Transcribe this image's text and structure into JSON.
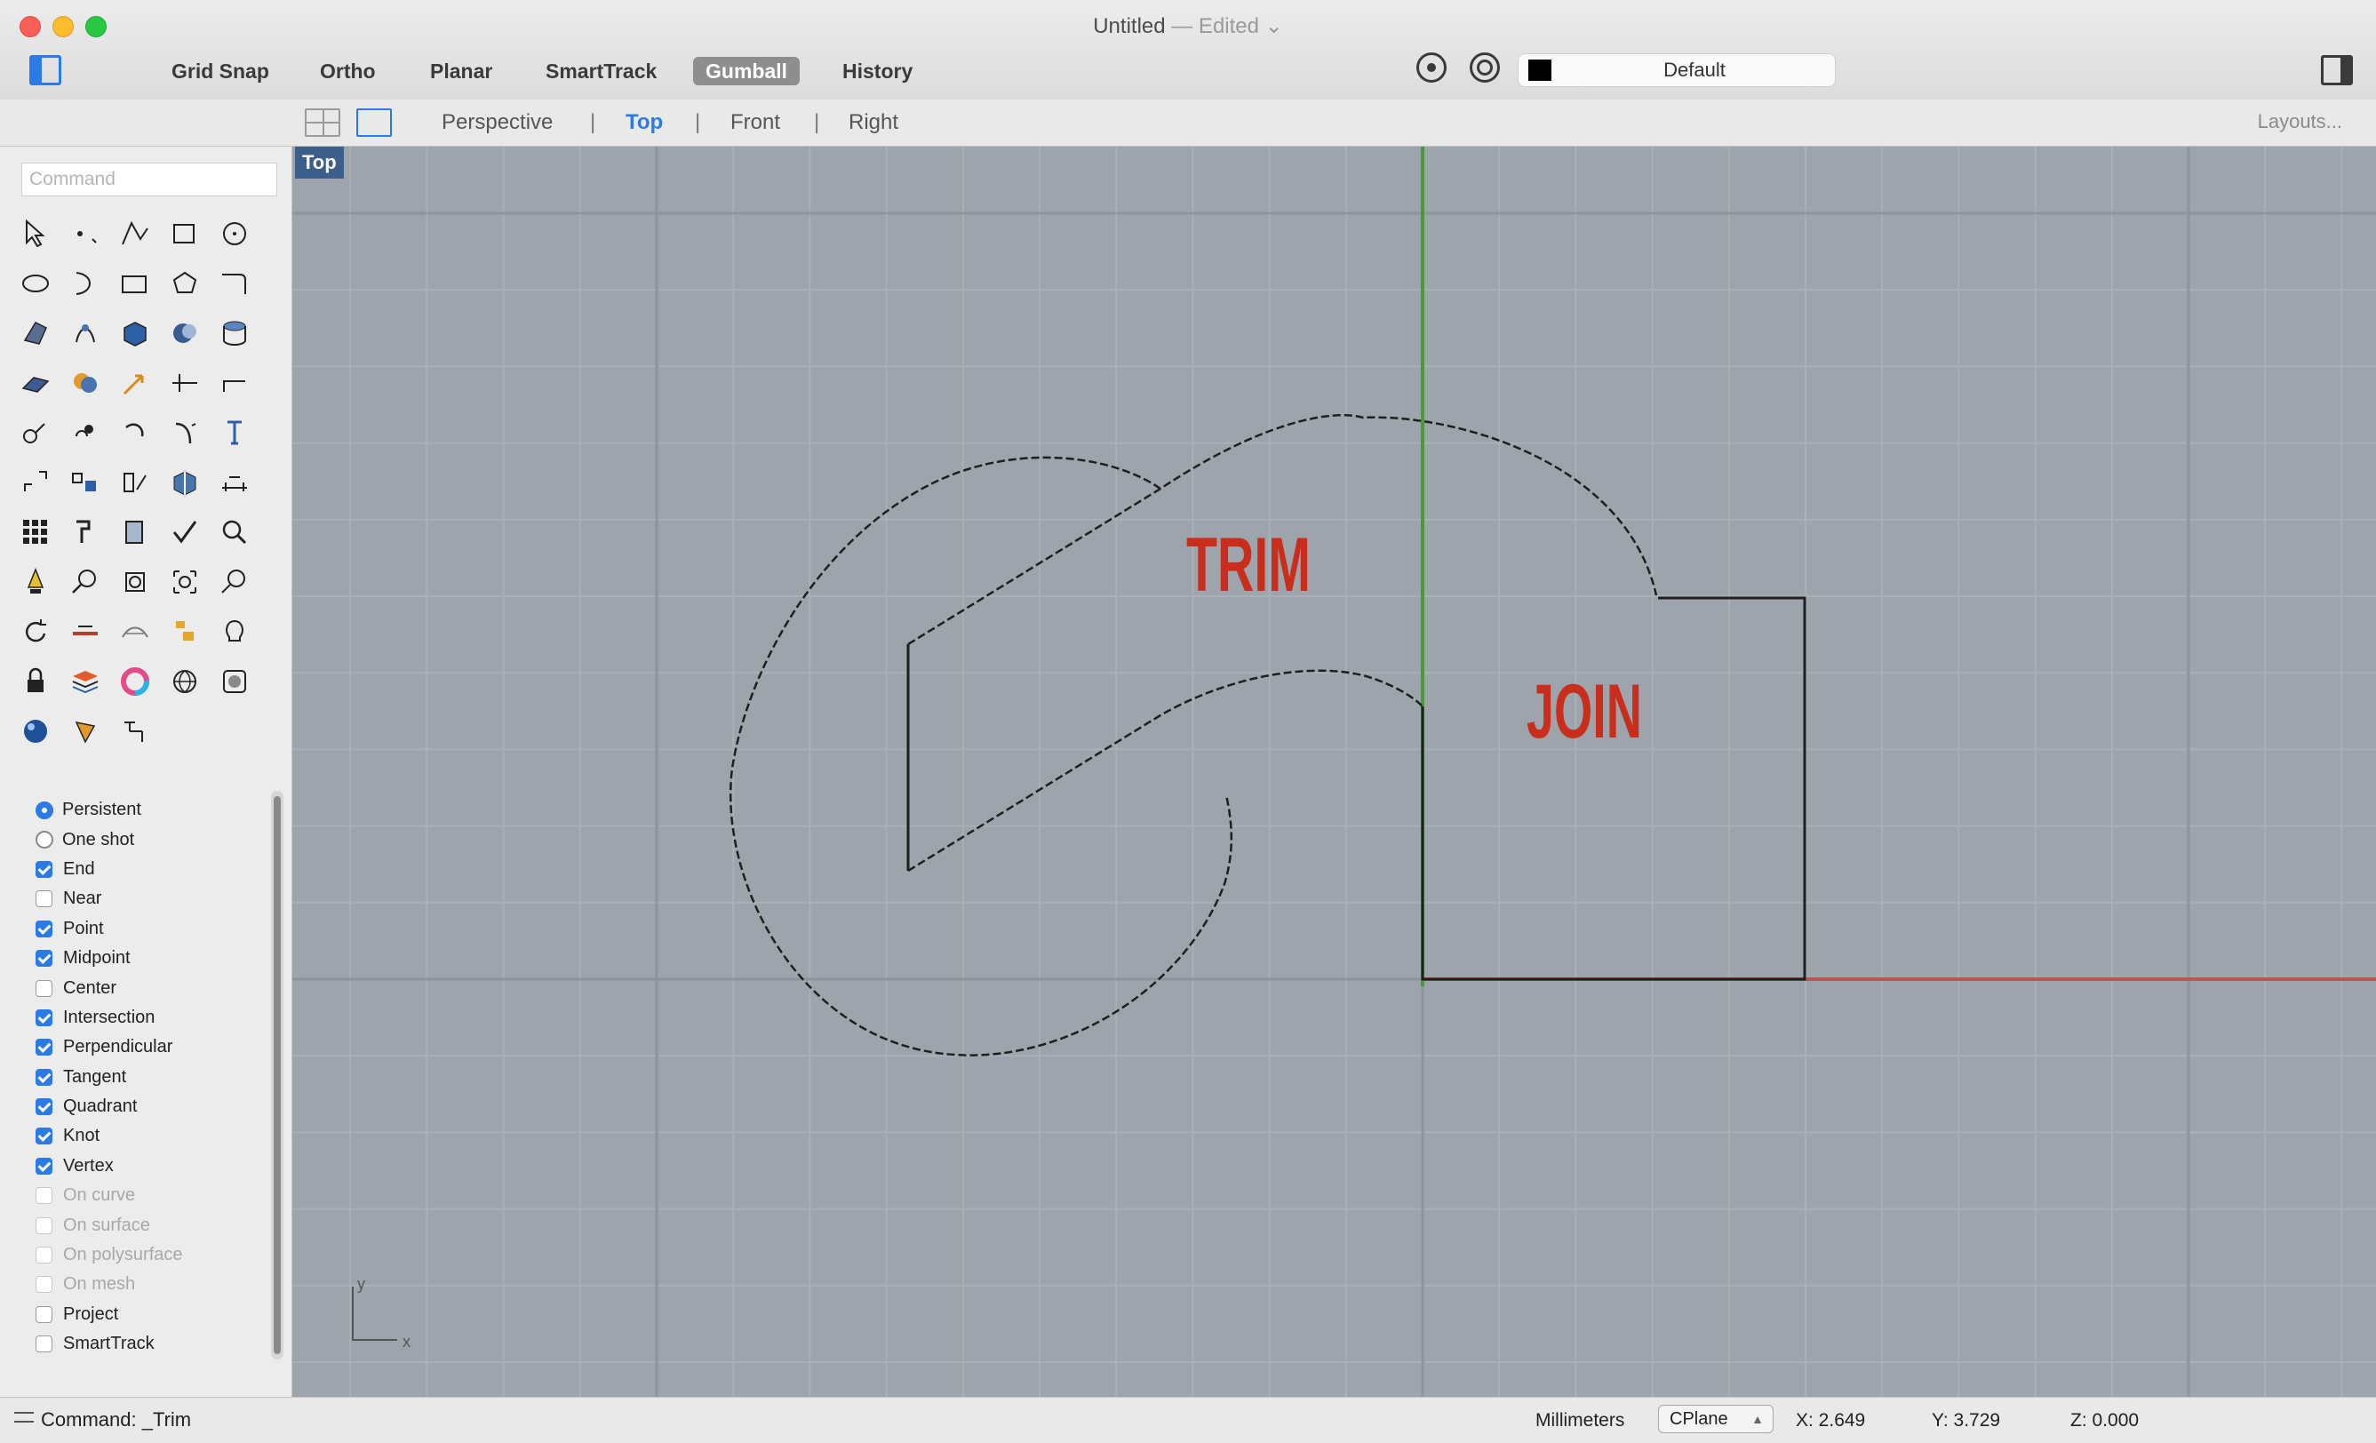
{
  "window": {
    "title": "Untitled",
    "edited": "— Edited ⌄"
  },
  "toolbar": {
    "modes": [
      {
        "label": "Grid Snap",
        "active": false
      },
      {
        "label": "Ortho",
        "active": false
      },
      {
        "label": "Planar",
        "active": false
      },
      {
        "label": "SmartTrack",
        "active": false
      },
      {
        "label": "Gumball",
        "active": true
      },
      {
        "label": "History",
        "active": false
      }
    ],
    "layer": {
      "name": "Default",
      "color": "#000000"
    }
  },
  "viewport_tabs": {
    "tabs": [
      "Perspective",
      "Top",
      "Front",
      "Right"
    ],
    "active": "Top",
    "layouts_link": "Layouts..."
  },
  "command": {
    "placeholder": "Command",
    "status": "Command: _Trim"
  },
  "tool_icons": [
    "select-arrow-icon",
    "point-icon",
    "polyline-icon",
    "curve-icon",
    "circle-icon",
    "ellipse-icon",
    "arc-icon",
    "rectangle-icon",
    "polygon-icon",
    "fillet-icon",
    "surface-icon",
    "loft-icon",
    "box-icon",
    "sphere-icon",
    "cylinder-icon",
    "extrude-icon",
    "boolean-icon",
    "move-icon",
    "trim-icon",
    "split-icon",
    "shell-icon",
    "group-icon",
    "rotate-icon",
    "scale-icon",
    "text-icon",
    "mirror-icon",
    "array-icon",
    "drape-icon",
    "solid-edit-icon",
    "dimension-icon",
    "grid-array-icon",
    "explode-icon",
    "paste-icon",
    "check-icon",
    "analyze-icon",
    "light-icon",
    "zoom-icon",
    "zoom-window-icon",
    "zoom-extents-icon",
    "zoom-selected-icon",
    "undo-view-icon",
    "section-icon",
    "mesh-icon",
    "properties-icon",
    "lightbulb-icon",
    "lock-icon",
    "layer-icon",
    "color-wheel-icon",
    "render-icon",
    "display-icon",
    "material-icon",
    "sun-icon",
    "snapshot-icon"
  ],
  "osnaps": {
    "modes": [
      {
        "label": "Persistent",
        "selected": true
      },
      {
        "label": "One shot",
        "selected": false
      }
    ],
    "items": [
      {
        "label": "End",
        "checked": true,
        "enabled": true
      },
      {
        "label": "Near",
        "checked": false,
        "enabled": true
      },
      {
        "label": "Point",
        "checked": true,
        "enabled": true
      },
      {
        "label": "Midpoint",
        "checked": true,
        "enabled": true
      },
      {
        "label": "Center",
        "checked": false,
        "enabled": true
      },
      {
        "label": "Intersection",
        "checked": true,
        "enabled": true
      },
      {
        "label": "Perpendicular",
        "checked": true,
        "enabled": true
      },
      {
        "label": "Tangent",
        "checked": true,
        "enabled": true
      },
      {
        "label": "Quadrant",
        "checked": true,
        "enabled": true
      },
      {
        "label": "Knot",
        "checked": true,
        "enabled": true
      },
      {
        "label": "Vertex",
        "checked": true,
        "enabled": true
      },
      {
        "label": "On curve",
        "checked": false,
        "enabled": false
      },
      {
        "label": "On surface",
        "checked": false,
        "enabled": false
      },
      {
        "label": "On polysurface",
        "checked": false,
        "enabled": false
      },
      {
        "label": "On mesh",
        "checked": false,
        "enabled": false
      },
      {
        "label": "Project",
        "checked": false,
        "enabled": true
      },
      {
        "label": "SmartTrack",
        "checked": false,
        "enabled": true
      }
    ]
  },
  "viewport": {
    "name": "Top",
    "annotations": {
      "trim": "TRIM",
      "join": "JOIN"
    },
    "axis_labels": {
      "x": "x",
      "y": "y"
    },
    "colors": {
      "background": "#9da4ac",
      "x_axis": "#c25252",
      "y_axis": "#4a9a3a",
      "annotation": "#c92e1d"
    }
  },
  "status": {
    "units": "Millimeters",
    "cplane": "CPlane",
    "x": "X: 2.649",
    "y": "Y: 3.729",
    "z": "Z: 0.000"
  }
}
